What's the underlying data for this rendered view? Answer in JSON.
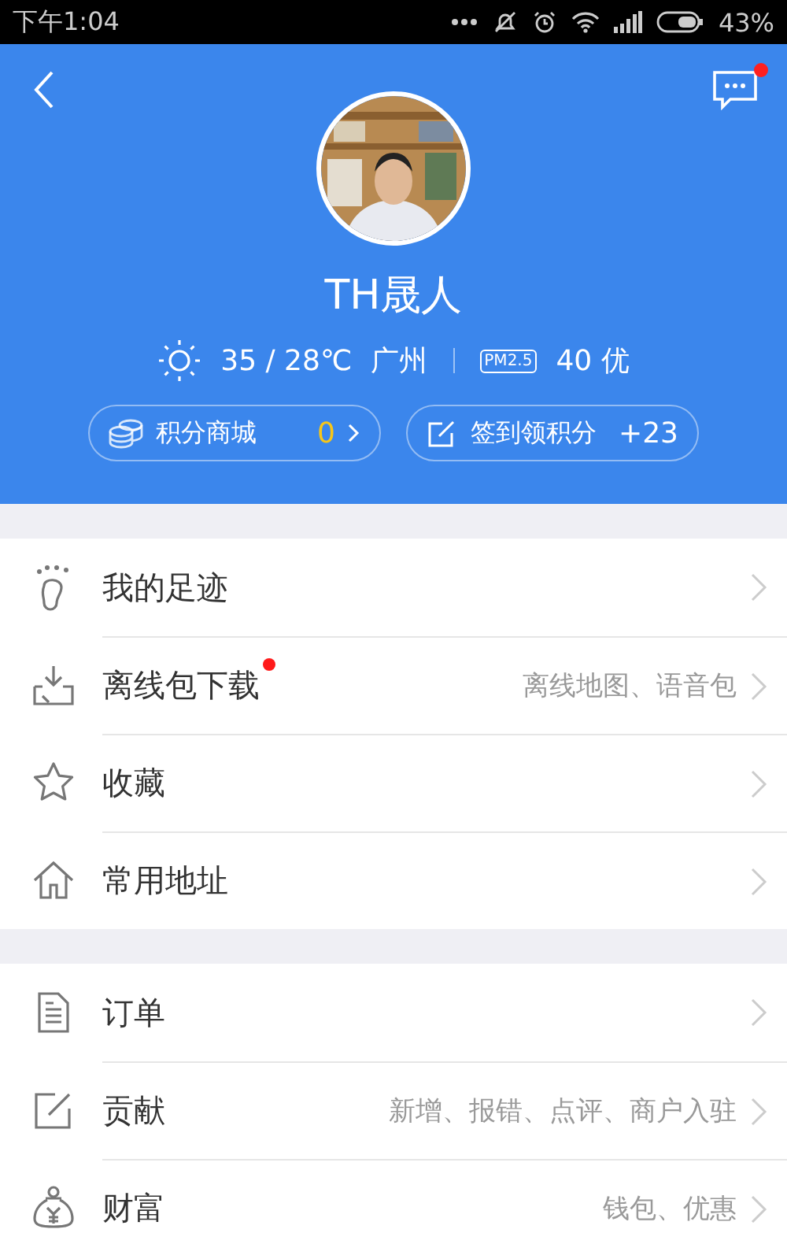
{
  "status_bar": {
    "time": "下午1:04",
    "battery": "43%"
  },
  "header": {
    "message_unread": true,
    "name": "TH晟人",
    "temperature": "35 / 28℃",
    "city": "广州",
    "aqi_badge": "PM2.5",
    "aqi": "40 优"
  },
  "points": [
    {
      "label": "积分商城",
      "value": "0",
      "highlight": true,
      "arrow": true,
      "kind": "coins"
    },
    {
      "label": "签到领积分",
      "value": "+23",
      "highlight": false,
      "arrow": false,
      "kind": "checkin"
    }
  ],
  "sections": [
    {
      "items": [
        {
          "kind": "footprint",
          "label": "我的足迹",
          "dot": false
        },
        {
          "kind": "download",
          "label": "离线包下载",
          "dot": true,
          "hint": "离线地图、语音包"
        },
        {
          "kind": "star",
          "label": "收藏",
          "dot": false
        },
        {
          "kind": "home",
          "label": "常用地址",
          "dot": false
        }
      ]
    },
    {
      "items": [
        {
          "kind": "document",
          "label": "订单",
          "dot": false
        },
        {
          "kind": "edit",
          "label": "贡献",
          "dot": false,
          "hint": "新增、报错、点评、商户入驻"
        },
        {
          "kind": "wallet",
          "label": "财富",
          "dot": false,
          "hint": "钱包、优惠"
        }
      ]
    }
  ]
}
